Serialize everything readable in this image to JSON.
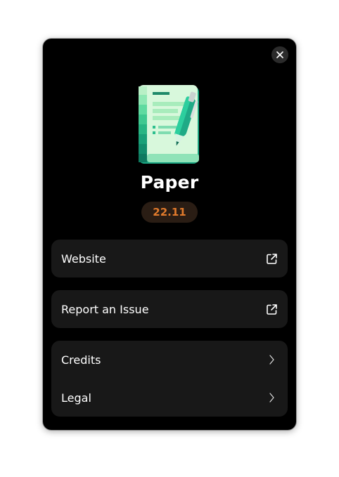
{
  "app": {
    "name": "Paper",
    "version": "22.11"
  },
  "colors": {
    "accent": "#e07a2c",
    "icon_green": "#3dd6a0"
  },
  "icons": {
    "close": "close-icon",
    "external": "external-link-icon",
    "chevron": "chevron-right-icon"
  },
  "links": {
    "website": "Website",
    "report": "Report an Issue"
  },
  "nav": {
    "credits": "Credits",
    "legal": "Legal"
  }
}
